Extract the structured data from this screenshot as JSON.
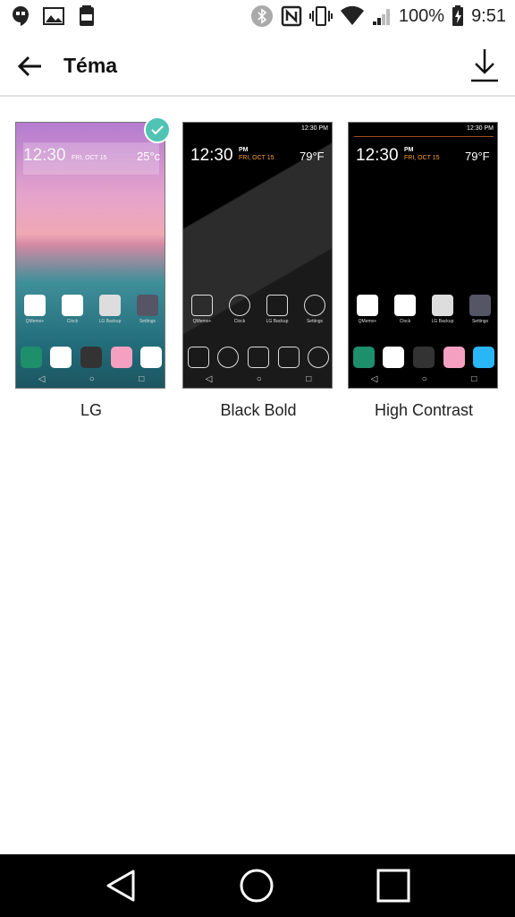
{
  "status_bar": {
    "battery": "100%",
    "time": "9:51",
    "left_icons": [
      "hangouts-icon",
      "gallery-icon",
      "data-saver-icon"
    ],
    "right_icons": [
      "bluetooth-icon",
      "nfc-icon",
      "vibrate-icon",
      "wifi-icon",
      "signal-icon",
      "battery-icon"
    ]
  },
  "app_bar": {
    "title": "Téma",
    "back_icon": "arrow-left-icon",
    "download_icon": "download-icon"
  },
  "themes": [
    {
      "label": "LG",
      "selected": true,
      "preview": {
        "clock": "12:30",
        "date": "FRI, OCT 15",
        "temp": "25°c",
        "apps": [
          "QMemo+",
          "Clock",
          "LG Backup",
          "Settings"
        ]
      }
    },
    {
      "label": "Black Bold",
      "selected": false,
      "preview": {
        "clock": "12:30",
        "pm": "PM",
        "date": "FRI, OCT 15",
        "temp": "79°F",
        "status_time": "12:30 PM",
        "apps": [
          "QMemo+",
          "Clock",
          "LG Backup",
          "Settings"
        ]
      }
    },
    {
      "label": "High Contrast",
      "selected": false,
      "preview": {
        "clock": "12:30",
        "pm": "PM",
        "date": "FRI, OCT 15",
        "temp": "79°F",
        "status_time": "12:30 PM",
        "apps": [
          "QMemo+",
          "Clock",
          "LG Backup",
          "Settings"
        ]
      }
    }
  ],
  "nav_bar": {
    "back": "back-triangle-icon",
    "home": "home-circle-icon",
    "recents": "recents-square-icon"
  },
  "colors": {
    "check": "#4fc3b4",
    "date_accent": "#ffa133"
  }
}
